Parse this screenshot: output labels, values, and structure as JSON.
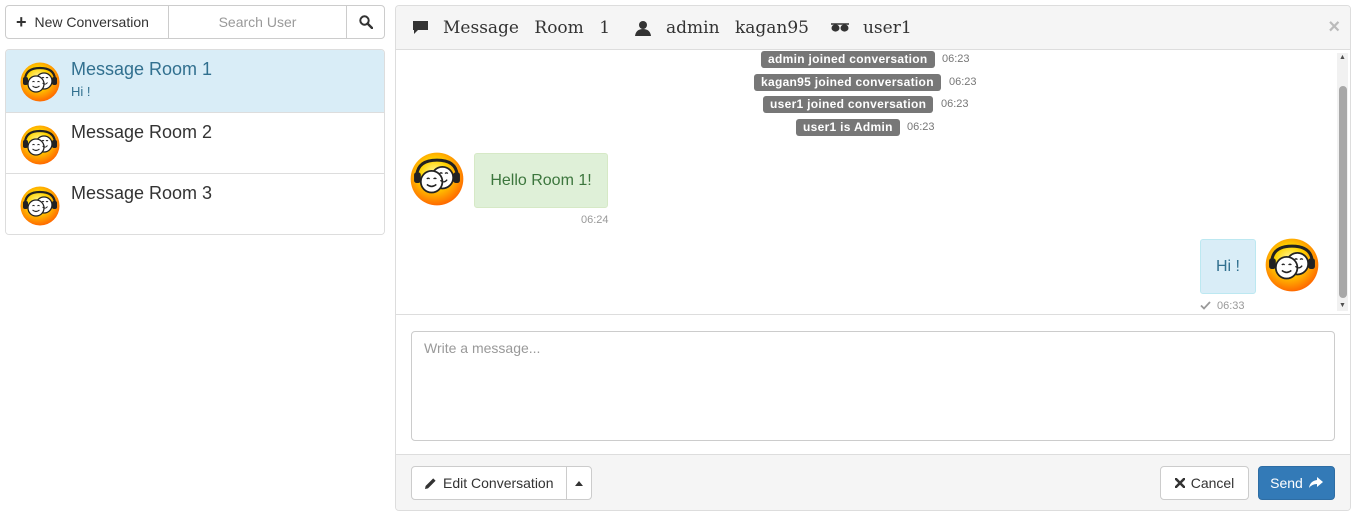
{
  "toolbar": {
    "new_conversation_label": "New Conversation",
    "search_placeholder": "Search User",
    "icons": {
      "new": "plus-icon",
      "search": "search-icon"
    }
  },
  "rooms": [
    {
      "name": "Message Room 1",
      "preview": "Hi !",
      "active": true
    },
    {
      "name": "Message Room 2",
      "preview": ""
    },
    {
      "name": "Message Room 3",
      "preview": ""
    }
  ],
  "header": {
    "title": "Message Room 1",
    "members": "admin kagan95",
    "watcher": "user1",
    "close": "×",
    "icons": {
      "room": "comment-icon",
      "members": "user-icon",
      "watcher": "sunglasses-icon"
    }
  },
  "system_messages": [
    {
      "text": "admin joined conversation",
      "time": "06:23"
    },
    {
      "text": "kagan95 joined conversation",
      "time": "06:23"
    },
    {
      "text": "user1 joined conversation",
      "time": "06:23"
    },
    {
      "text": "user1 is Admin",
      "time": "06:23"
    }
  ],
  "messages": [
    {
      "direction": "in",
      "text": "Hello Room 1!",
      "time": "06:24"
    },
    {
      "direction": "out",
      "text": "Hi !",
      "time": "06:33",
      "status": "check-icon"
    }
  ],
  "compose": {
    "placeholder": "Write a message..."
  },
  "footer": {
    "edit_label": "Edit Conversation",
    "cancel_label": "Cancel",
    "send_label": "Send"
  },
  "colors": {
    "active_room_bg": "#d9edf7",
    "active_text": "#31708f",
    "incoming_bubble": "#dff0d8",
    "outgoing_bubble": "#d9edf7",
    "system_badge": "#777777",
    "primary": "#337ab7"
  }
}
